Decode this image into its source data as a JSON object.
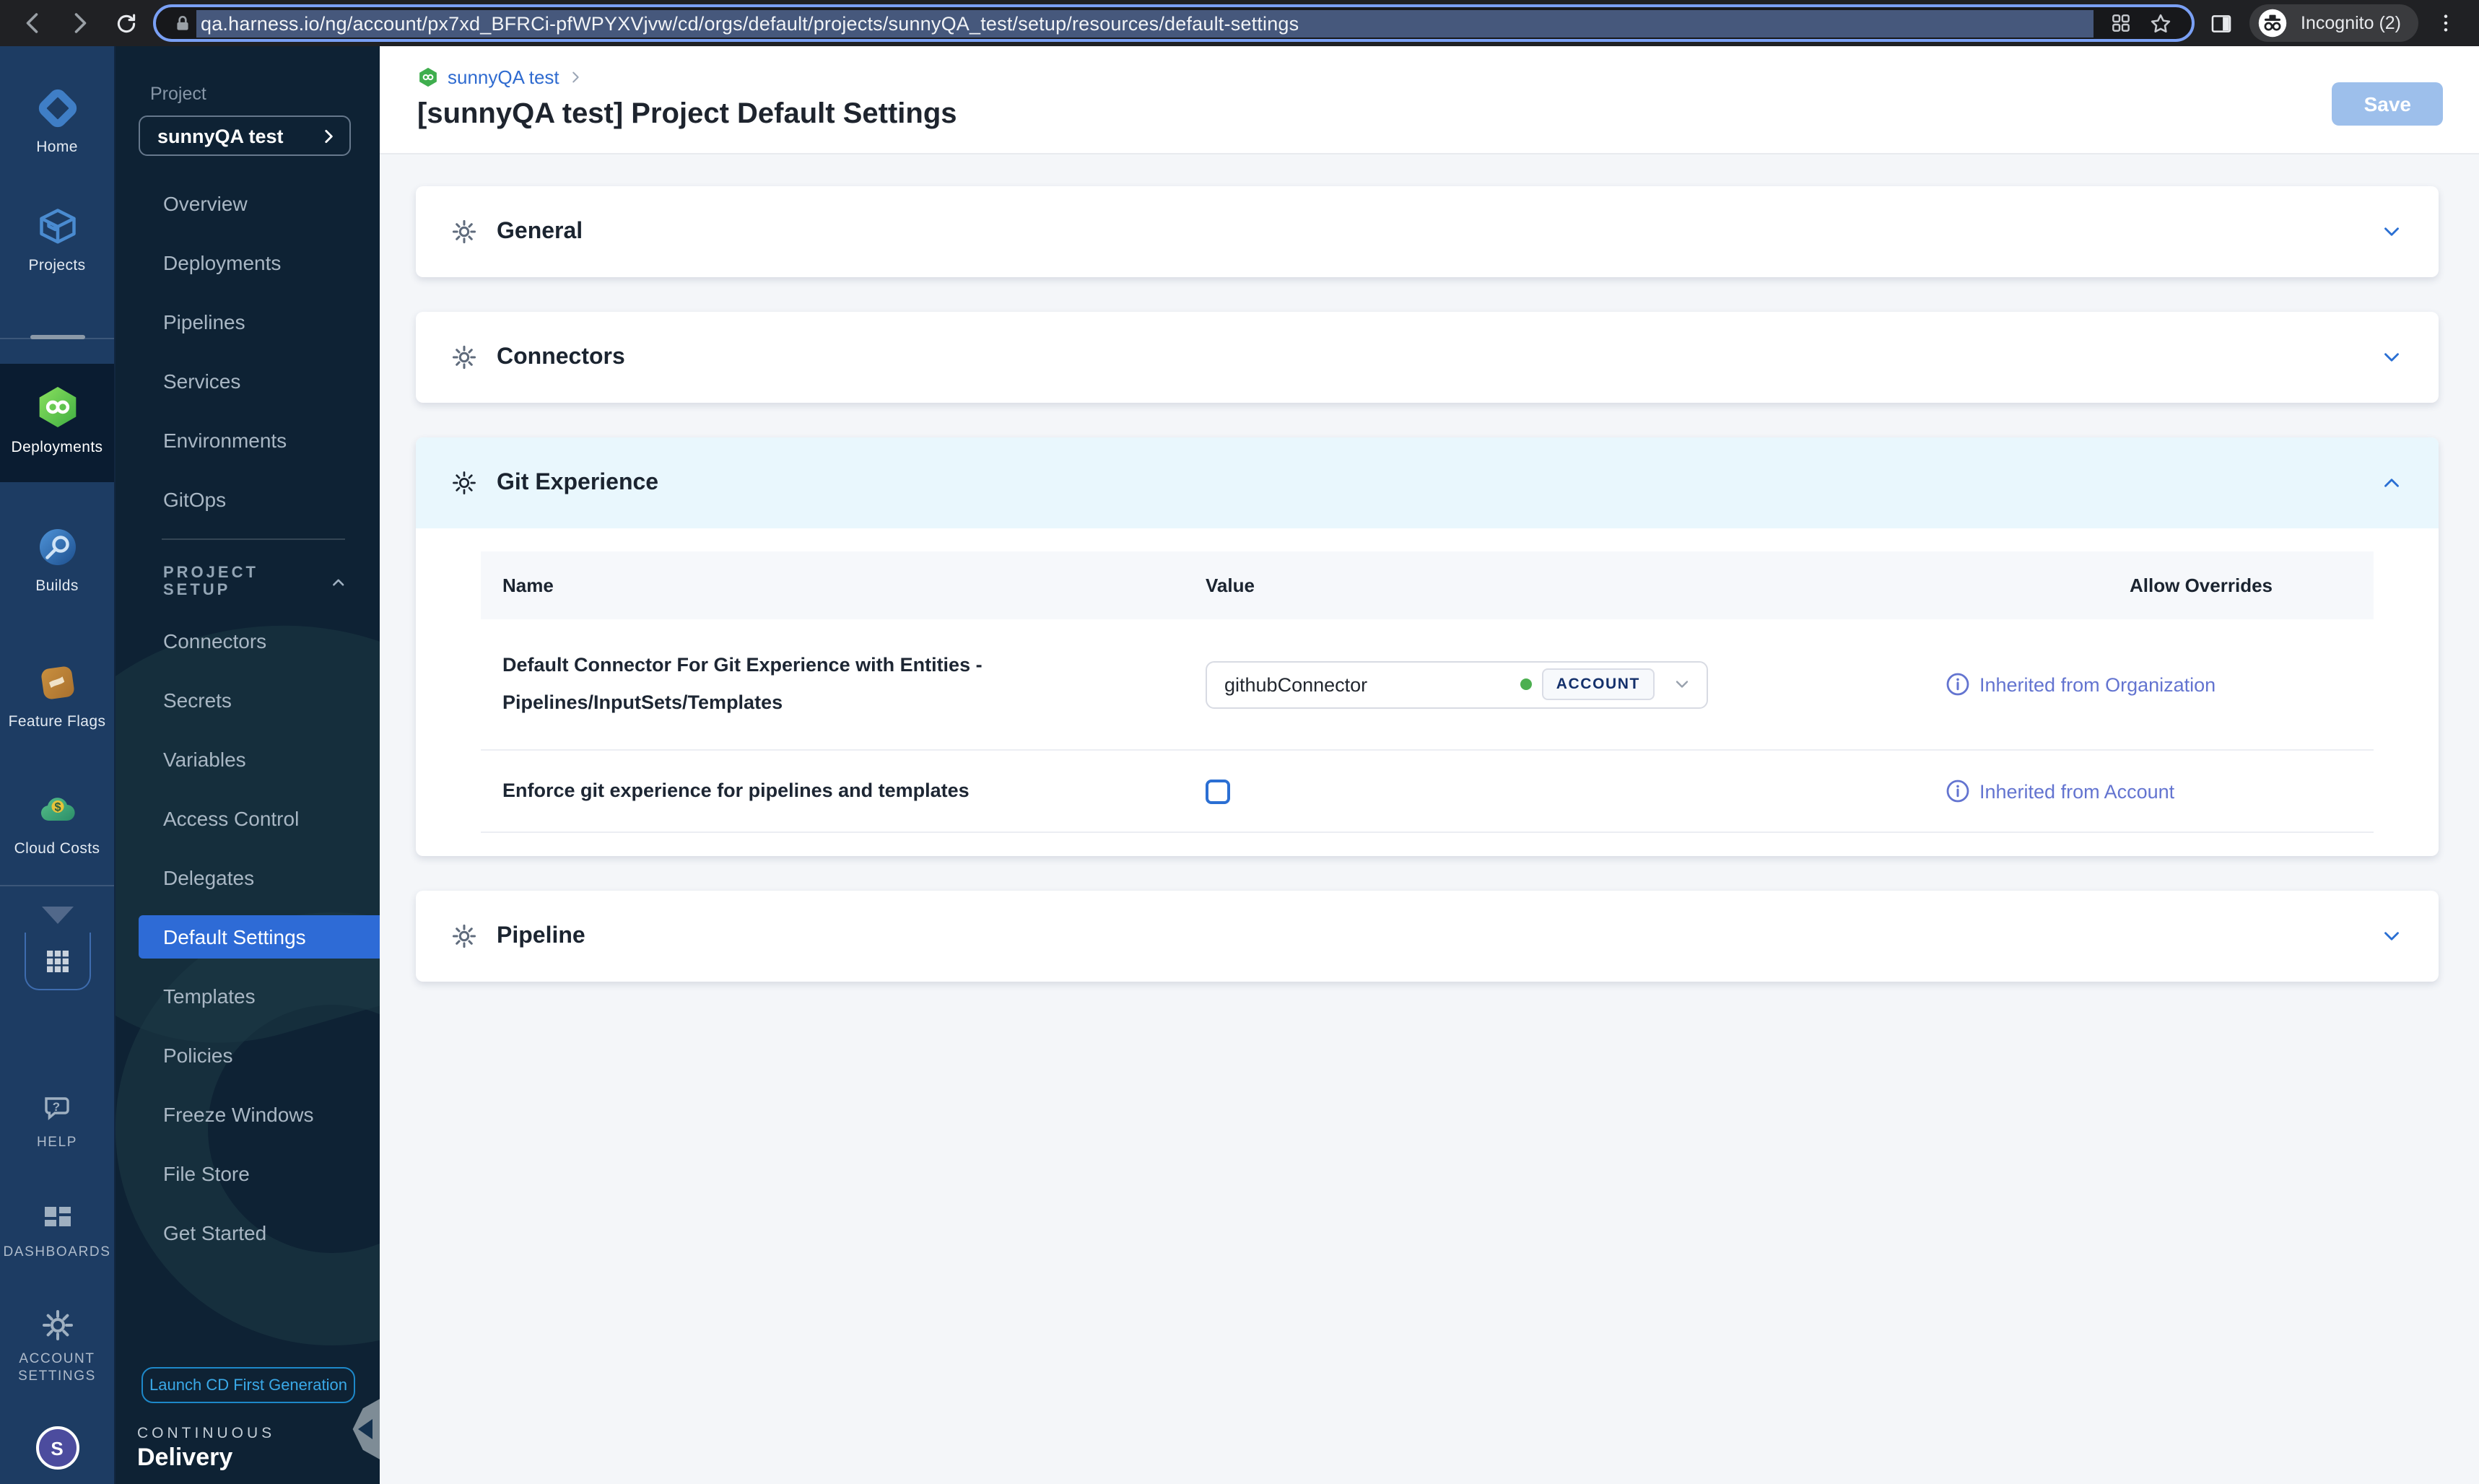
{
  "browser": {
    "url": "qa.harness.io/ng/account/px7xd_BFRCi-pfWPYXVjvw/cd/orgs/default/projects/sunnyQA_test/setup/resources/default-settings",
    "incognito_label": "Incognito (2)"
  },
  "module_nav": {
    "items": [
      {
        "label": "Home"
      },
      {
        "label": "Projects"
      },
      {
        "label": "Deployments",
        "active": true
      },
      {
        "label": "Builds"
      },
      {
        "label": "Feature Flags"
      },
      {
        "label": "Cloud Costs"
      }
    ],
    "bottom_items": [
      {
        "label": "HELP"
      },
      {
        "label": "DASHBOARDS"
      },
      {
        "label": "ACCOUNT SETTINGS"
      }
    ],
    "avatar_initial": "S"
  },
  "project_nav": {
    "project_label": "Project",
    "project_name": "sunnyQA test",
    "items": [
      "Overview",
      "Deployments",
      "Pipelines",
      "Services",
      "Environments",
      "GitOps"
    ],
    "setup_heading": "PROJECT SETUP",
    "setup_items": [
      "Connectors",
      "Secrets",
      "Variables",
      "Access Control",
      "Delegates",
      "Default Settings",
      "Templates",
      "Policies",
      "Freeze Windows",
      "File Store",
      "Get Started"
    ],
    "active_item": "Default Settings",
    "launch_button": "Launch CD First Generation",
    "footer_line1": "CONTINUOUS",
    "footer_line2": "Delivery"
  },
  "header": {
    "breadcrumb": "sunnyQA test",
    "title": "[sunnyQA test] Project Default Settings",
    "save_label": "Save"
  },
  "sections": {
    "general": "General",
    "connectors": "Connectors",
    "git_experience": "Git Experience",
    "pipeline": "Pipeline"
  },
  "git_table": {
    "columns": [
      "Name",
      "Value",
      "Allow Overrides"
    ],
    "rows": [
      {
        "name": "Default Connector For Git Experience with Entities - Pipelines/InputSets/Templates",
        "value": "githubConnector",
        "scope": "ACCOUNT",
        "override": "Inherited from Organization"
      },
      {
        "name": "Enforce git experience for pipelines and templates",
        "checked": false,
        "override": "Inherited from Account"
      }
    ]
  },
  "colors": {
    "accent_blue": "#2e6bd6",
    "link_indigo": "#6374d0",
    "save_disabled": "#9dbfeb",
    "cd_green": "#42b450",
    "gitx_header_bg": "#e9f7fd"
  }
}
